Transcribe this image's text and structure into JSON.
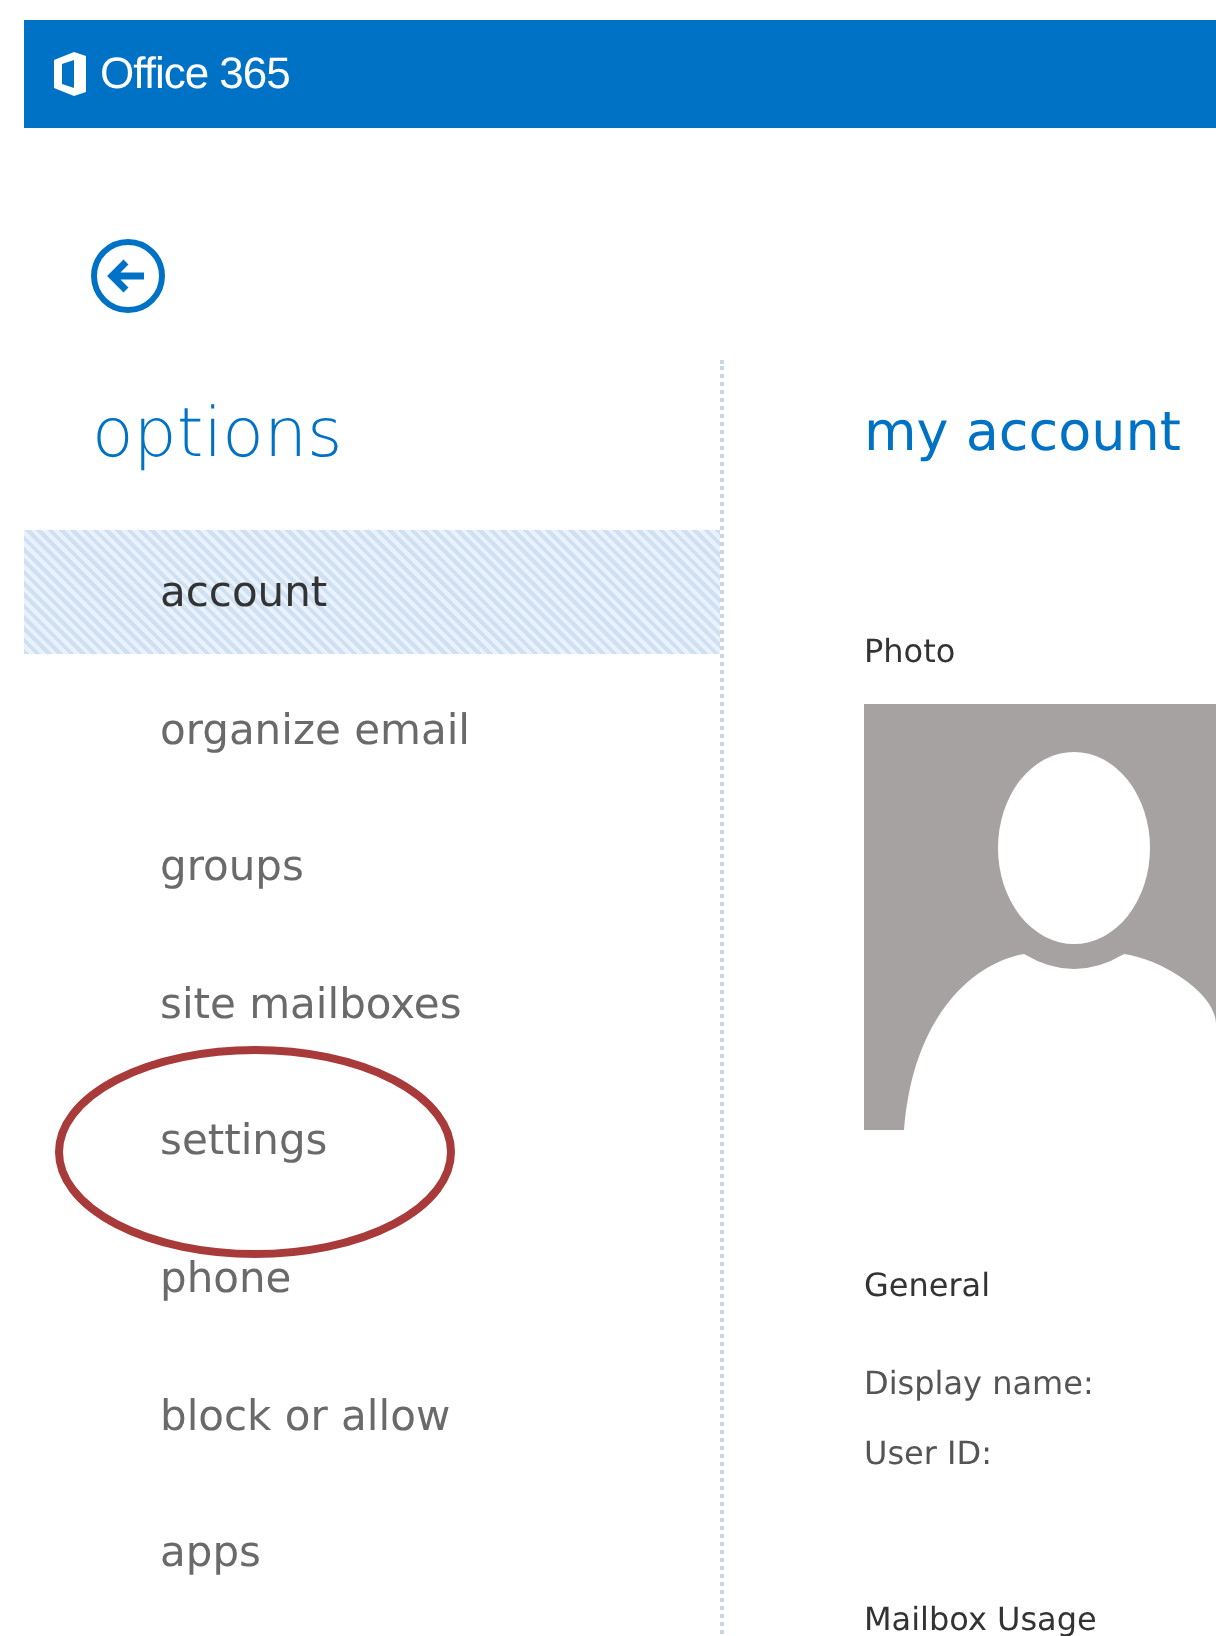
{
  "header": {
    "product": "Office 365"
  },
  "sidebar": {
    "title": "options",
    "items": [
      {
        "label": "account",
        "selected": true,
        "circled": false
      },
      {
        "label": "organize email",
        "selected": false,
        "circled": false
      },
      {
        "label": "groups",
        "selected": false,
        "circled": false
      },
      {
        "label": "site mailboxes",
        "selected": false,
        "circled": false
      },
      {
        "label": "settings",
        "selected": false,
        "circled": true
      },
      {
        "label": "phone",
        "selected": false,
        "circled": false
      },
      {
        "label": "block or allow",
        "selected": false,
        "circled": false
      },
      {
        "label": "apps",
        "selected": false,
        "circled": false
      }
    ]
  },
  "main": {
    "title": "my account",
    "photo_label": "Photo",
    "general_heading": "General",
    "fields": [
      "Display name:",
      "User ID:"
    ],
    "mailbox_heading": "Mailbox Usage"
  }
}
